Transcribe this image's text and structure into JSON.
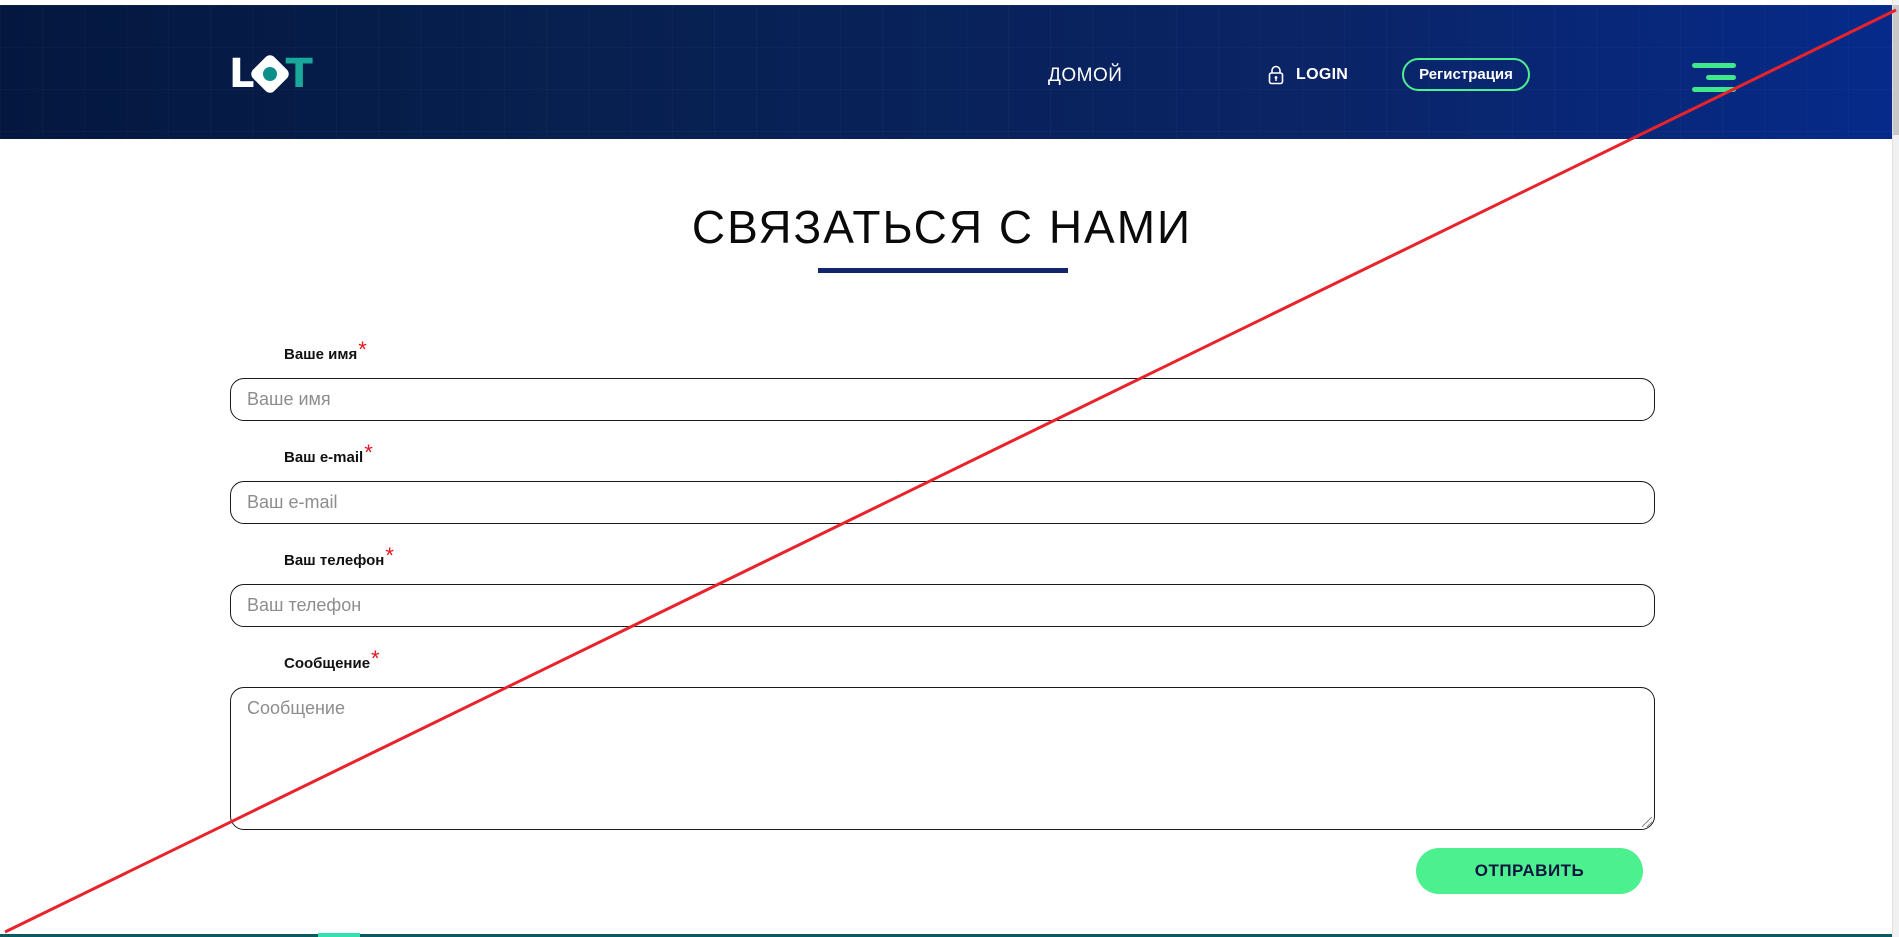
{
  "header": {
    "logo_text_l": "L",
    "logo_text_t": "T",
    "nav_home": "ДОМОЙ",
    "nav_login": "LOGIN",
    "nav_register": "Регистрация"
  },
  "main": {
    "title": "СВЯЗАТЬСЯ С НАМИ",
    "required_mark": "*",
    "fields": [
      {
        "label": "Ваше имя",
        "placeholder": "Ваше имя",
        "value": ""
      },
      {
        "label": "Ваш e-mail",
        "placeholder": "Ваш e-mail",
        "value": ""
      },
      {
        "label": "Ваш телефон",
        "placeholder": "Ваш телефон",
        "value": ""
      },
      {
        "label": "Сообщение",
        "placeholder": "Сообщение",
        "value": ""
      }
    ],
    "submit_label": "ОТПРАВИТЬ"
  },
  "icons": {
    "lock": "lock-icon",
    "menu": "hamburger-menu-icon"
  },
  "colors": {
    "header_start": "#04173f",
    "header_end": "#062a8a",
    "accent_green": "#4cf08e",
    "title_underline": "#12266a",
    "required_red": "#e4161e",
    "annotation_red": "#e8232b"
  }
}
